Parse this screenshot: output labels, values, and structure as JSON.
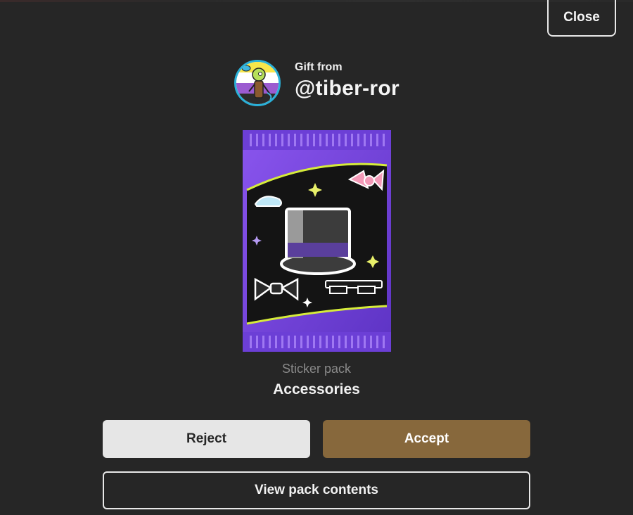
{
  "close_button": {
    "label": "Close"
  },
  "sender": {
    "label": "Gift from",
    "username": "@tiber-ror"
  },
  "pack": {
    "type_label": "Sticker pack",
    "name": "Accessories"
  },
  "actions": {
    "reject_label": "Reject",
    "accept_label": "Accept",
    "view_contents_label": "View pack contents"
  },
  "colors": {
    "background": "#262626",
    "accept": "#87683c",
    "reject": "#e6e6e6",
    "pack_purple": "#7b45e0",
    "pack_accent": "#d6ec3a"
  },
  "icons": {
    "avatar": "user-avatar-icon",
    "pack": "sticker-pack-icon"
  }
}
